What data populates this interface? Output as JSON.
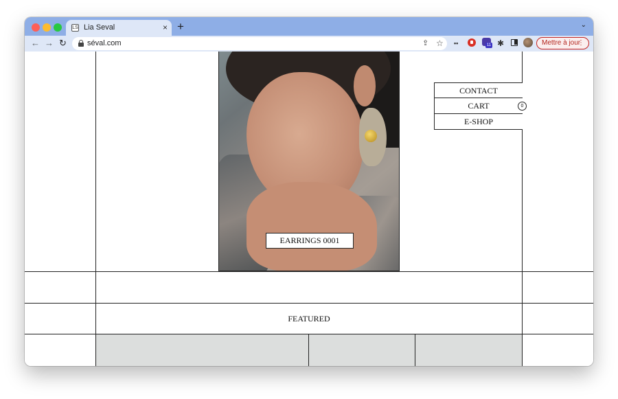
{
  "browser": {
    "tab": {
      "title": "Lia Seval",
      "close_glyph": "×",
      "favicon_glyph": "LS"
    },
    "new_tab_glyph": "+",
    "tab_menu_glyph": "⌄",
    "nav": {
      "back": "←",
      "forward": "→",
      "reload": "↻"
    },
    "address": {
      "url": "séval.com"
    },
    "icons": {
      "share": "⇪",
      "star": "☆",
      "keys": "••",
      "puzzle": "✱"
    },
    "extension_badge": "11",
    "update_button": {
      "label": "Mettre à jour",
      "menu_glyph": "⋮"
    }
  },
  "site": {
    "product_label": "EARRINGS 0001",
    "menu": [
      {
        "label": "CONTACT"
      },
      {
        "label": "CART"
      },
      {
        "label": "E-SHOP"
      }
    ],
    "cart_count": "0",
    "section_title": "FEATURED"
  }
}
